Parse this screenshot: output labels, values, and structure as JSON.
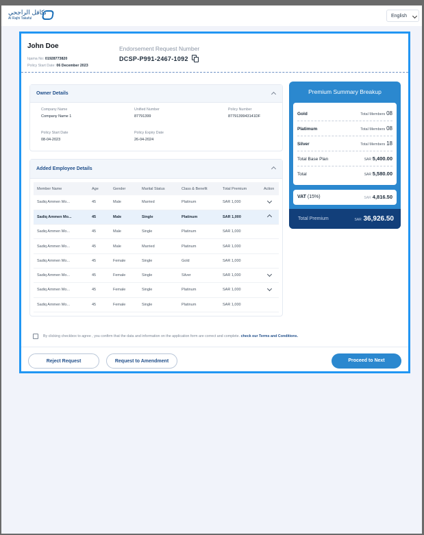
{
  "topbar": {
    "logo_ar": "تكافل الراجحي",
    "logo_en": "Al Rajhi Takaful",
    "language": "English"
  },
  "header": {
    "name": "John Doe",
    "iqama_label": "Iqama No:",
    "iqama_value": "01928773820",
    "policy_start_label": "Policy Start Date:",
    "policy_start_value": "06 December 2023",
    "endorsement_label": "Endorsement Request Number",
    "endorsement_number": "DCSP-P991-2467-1092"
  },
  "owner_details": {
    "title": "Owner Details",
    "fields": [
      {
        "label": "Company Name",
        "value": "Company Name 1"
      },
      {
        "label": "Unified Number",
        "value": "87791399"
      },
      {
        "label": "Policy Number",
        "value": "8779139943141DF"
      },
      {
        "label": "Policy Start Date",
        "value": "08-04-2023"
      },
      {
        "label": "Policy Expiry Date",
        "value": "26-04-2024"
      }
    ]
  },
  "employees": {
    "title": "Added Employee Details",
    "columns": [
      "Member Name",
      "Age",
      "Gender",
      "Marital Status",
      "Class & Benefit",
      "Total Premium",
      "Action"
    ],
    "rows": [
      [
        "Sadiq Ammen Mo...",
        "45",
        "Male",
        "Married",
        "Platinum",
        "SAR 1,000",
        "chevron-down"
      ],
      [
        "Sadiq Ammen Mo...",
        "45",
        "Male",
        "Single",
        "Platinum",
        "SAR 1,000",
        "chevron-up"
      ],
      [
        "Sadiq Ammen Mo...",
        "45",
        "Male",
        "Single",
        "Platinum",
        "SAR 1,000",
        ""
      ],
      [
        "Sadiq Ammen Mo...",
        "45",
        "Male",
        "Married",
        "Platinum",
        "SAR 1,000",
        ""
      ],
      [
        "Sadiq Ammen Mo...",
        "45",
        "Female",
        "Single",
        "Gold",
        "SAR 1,000",
        ""
      ],
      [
        "Sadiq Ammen Mo...",
        "45",
        "Female",
        "Single",
        "Silver",
        "SAR 1,000",
        "chevron-down"
      ],
      [
        "Sadiq Ammen Mo...",
        "45",
        "Female",
        "Single",
        "Platinum",
        "SAR 1,000",
        "chevron-down"
      ],
      [
        "Sadiq Ammen Mo...",
        "45",
        "Female",
        "Single",
        "Platinum",
        "SAR 1,000",
        ""
      ]
    ]
  },
  "summary": {
    "title": "Premium Summary Breakup",
    "members_label": "Total Members",
    "tiers": [
      {
        "name": "Gold",
        "count": "08"
      },
      {
        "name": "Platimum",
        "count": "08"
      },
      {
        "name": "Silver",
        "count": "18"
      }
    ],
    "currency": "SAR",
    "base_plan_label": "Total Base Plan",
    "base_plan_value": "5,400.00",
    "total_label": "Total",
    "total_value": "5,580.00",
    "vat_label": "VAT",
    "vat_rate": "(15%)",
    "vat_value": "4,816.50",
    "premium_label": "Total Premium",
    "premium_value": "36,926.50"
  },
  "agreement": {
    "text": "By clicking checkbox to agree , you confirm that the data and information on the application form are correct and complete.",
    "link": "check our Terms and Conditions."
  },
  "actions": {
    "reject": "Reject Request",
    "amend": "Request to Amendment",
    "proceed": "Proceed to Next"
  },
  "colors": {
    "accent": "#2b88cf",
    "dark_blue": "#123f7a",
    "border_highlight": "#2196f3"
  }
}
